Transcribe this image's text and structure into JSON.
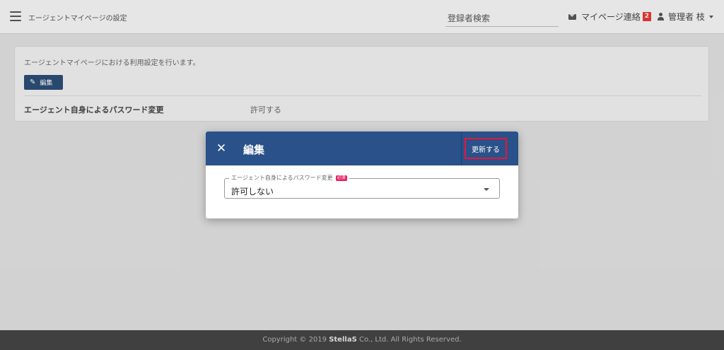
{
  "header": {
    "title": "エージェントマイページの設定",
    "search_label": "登録者検索",
    "mail_label": "マイページ連絡",
    "mail_count": "2",
    "user_label": "管理者 枝"
  },
  "card": {
    "description": "エージェントマイページにおける利用設定を行います。",
    "edit_label": "編集",
    "setting_label": "エージェント自身によるパスワード変更",
    "setting_value": "許可する"
  },
  "modal": {
    "title": "編集",
    "update_label": "更新する",
    "field_label": "エージェント自身によるパスワード変更",
    "required_label": "必須",
    "field_value": "許可しない"
  },
  "footer": {
    "copyright_prefix": "Copyright © 2019 ",
    "brand": "StellaS",
    "copyright_suffix": " Co., Ltd. All Rights Reserved."
  },
  "colors": {
    "modal_header": "#2a5189",
    "edit_button": "#2c4d75",
    "badge": "#e53935",
    "highlight": "#e5163d",
    "required": "#e91e63",
    "footer": "#404040"
  },
  "icons": {
    "menu": "hamburger-icon",
    "mail": "envelope-icon",
    "user": "user-icon",
    "edit": "pencil-icon",
    "close": "close-icon",
    "dropdown": "chevron-down-icon"
  }
}
